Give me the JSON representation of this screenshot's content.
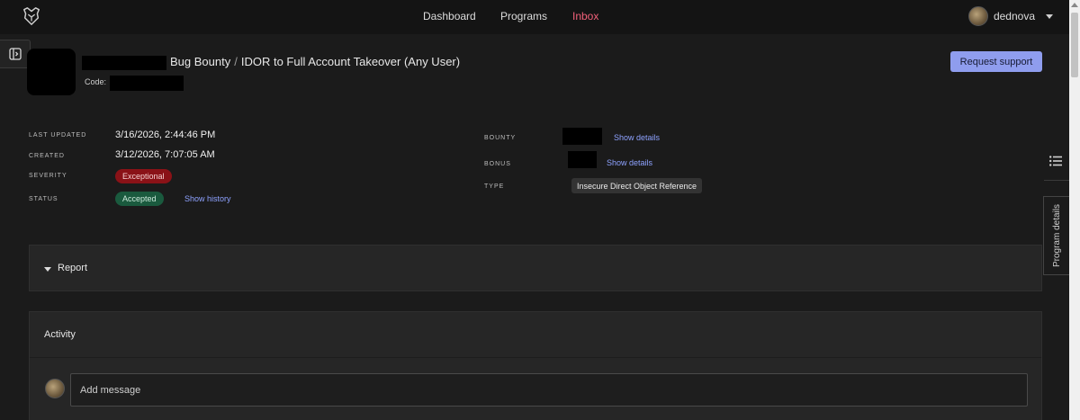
{
  "nav": {
    "items": [
      {
        "label": "Dashboard",
        "active": false
      },
      {
        "label": "Programs",
        "active": false
      },
      {
        "label": "Inbox",
        "active": true
      }
    ],
    "active_color": "#f2617a"
  },
  "user": {
    "name": "dednova"
  },
  "report": {
    "breadcrumb_program": "Bug Bounty",
    "breadcrumb_separator": "/",
    "title": "IDOR to Full Account Takeover (Any User)",
    "code_label": "Code:"
  },
  "actions": {
    "request_support": "Request support"
  },
  "meta": {
    "last_updated_label": "LAST UPDATED",
    "last_updated": "3/16/2026, 2:44:46 PM",
    "created_label": "CREATED",
    "created": "3/12/2026, 7:07:05 AM",
    "severity_label": "SEVERITY",
    "severity": "Exceptional",
    "status_label": "STATUS",
    "status": "Accepted",
    "show_history": "Show history",
    "bounty_label": "BOUNTY",
    "bonus_label": "BONUS",
    "show_details": "Show details",
    "type_label": "TYPE",
    "type": "Insecure Direct Object Reference"
  },
  "colors": {
    "severity_bg": "#8a1217",
    "status_bg": "#1a5a3e",
    "primary_button": "#8f9dee",
    "link": "#8ea2ff"
  },
  "rail": {
    "program_details": "Program details"
  },
  "sections": {
    "report": "Report",
    "activity": "Activity",
    "message_placeholder": "Add message"
  }
}
